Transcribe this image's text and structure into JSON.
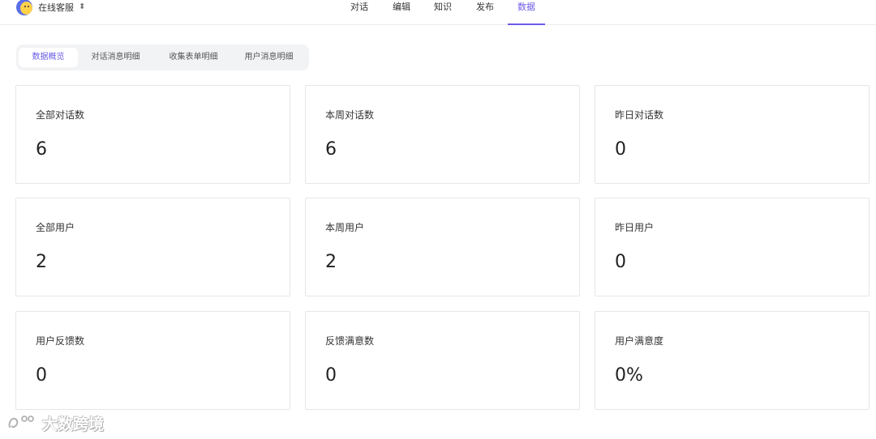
{
  "header": {
    "brand_name": "在线客服",
    "nav": [
      "对话",
      "编辑",
      "知识",
      "发布",
      "数据"
    ],
    "active_nav": "数据"
  },
  "subtabs": {
    "items": [
      "数据概览",
      "对话消息明细",
      "收集表单明细",
      "用户消息明细"
    ],
    "active": "数据概览"
  },
  "stats": [
    {
      "label": "全部对话数",
      "value": "6"
    },
    {
      "label": "本周对话数",
      "value": "6"
    },
    {
      "label": "昨日对话数",
      "value": "0"
    },
    {
      "label": "全部用户",
      "value": "2"
    },
    {
      "label": "本周用户",
      "value": "2"
    },
    {
      "label": "昨日用户",
      "value": "0"
    },
    {
      "label": "用户反馈数",
      "value": "0"
    },
    {
      "label": "反馈满意数",
      "value": "0"
    },
    {
      "label": "用户满意度",
      "value": "0%"
    }
  ],
  "watermark": "大数跨境",
  "colors": {
    "accent": "#6c5ce7"
  }
}
